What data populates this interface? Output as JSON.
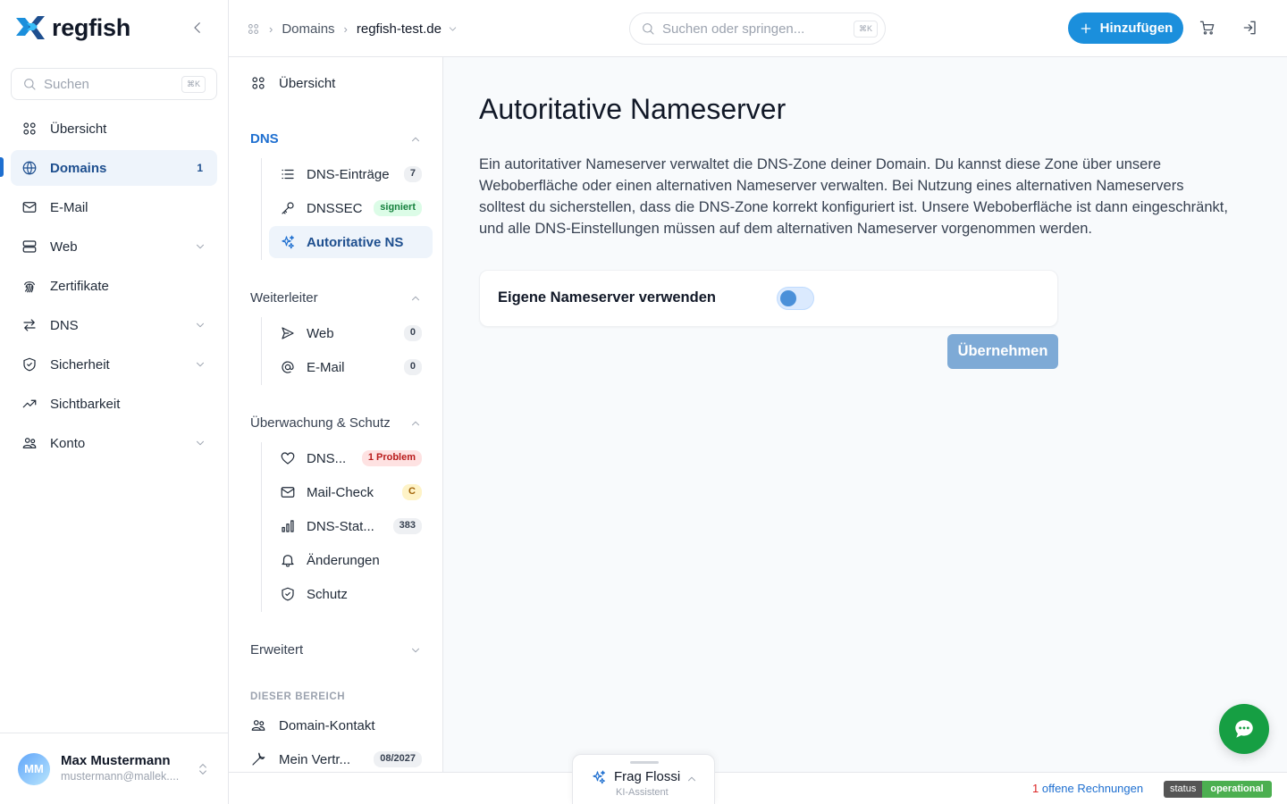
{
  "brand": {
    "name": "regfish"
  },
  "sidebar": {
    "search": {
      "placeholder": "Suchen",
      "shortcut": "⌘K"
    },
    "items": [
      {
        "label": "Übersicht",
        "icon": "grid-icon"
      },
      {
        "label": "Domains",
        "icon": "globe-icon",
        "count": "1",
        "active": true
      },
      {
        "label": "E-Mail",
        "icon": "mail-icon"
      },
      {
        "label": "Web",
        "icon": "server-icon",
        "expandable": true
      },
      {
        "label": "Zertifikate",
        "icon": "fingerprint-icon"
      },
      {
        "label": "DNS",
        "icon": "arrows-icon",
        "expandable": true
      },
      {
        "label": "Sicherheit",
        "icon": "shield-icon",
        "expandable": true
      },
      {
        "label": "Sichtbarkeit",
        "icon": "trend-icon"
      },
      {
        "label": "Konto",
        "icon": "users-icon",
        "expandable": true
      }
    ],
    "user": {
      "initials": "MM",
      "name": "Max Mustermann",
      "email": "mustermann@mallek...."
    }
  },
  "topbar": {
    "breadcrumb": {
      "root": "Domains",
      "current": "regfish-test.de"
    },
    "search": {
      "placeholder": "Suchen oder springen...",
      "shortcut": "⌘K"
    },
    "add_label": "Hinzufügen"
  },
  "subnav": {
    "overview": "Übersicht",
    "dns": {
      "title": "DNS",
      "items": [
        {
          "label": "DNS-Einträge",
          "badge": "7"
        },
        {
          "label": "DNSSEC",
          "badge": "signiert"
        },
        {
          "label": "Autoritative NS"
        }
      ]
    },
    "forward": {
      "title": "Weiterleiter",
      "items": [
        {
          "label": "Web",
          "badge": "0"
        },
        {
          "label": "E-Mail",
          "badge": "0"
        }
      ]
    },
    "monitor": {
      "title": "Überwachung & Schutz",
      "items": [
        {
          "label": "DNS...",
          "badge": "1 Problem"
        },
        {
          "label": "Mail-Check",
          "badge": "C"
        },
        {
          "label": "DNS-Stat...",
          "badge": "383"
        },
        {
          "label": "Änderungen"
        },
        {
          "label": "Schutz"
        }
      ]
    },
    "advanced": {
      "title": "Erweitert"
    },
    "section_label": "DIESER BEREICH",
    "area_items": [
      {
        "label": "Domain-Kontakt"
      },
      {
        "label": "Mein Vertr...",
        "badge": "08/2027"
      }
    ]
  },
  "main": {
    "title": "Autoritative Nameserver",
    "description": "Ein autoritativer Nameserver verwaltet die DNS-Zone deiner Domain. Du kannst diese Zone über unsere Weboberfläche oder einen alternativen Nameserver verwalten. Bei Nutzung eines alternativen Nameservers solltest du sicherstellen, dass die DNS-Zone korrekt konfiguriert ist. Unsere Weboberfläche ist dann eingeschränkt, und alle DNS-Einstellungen müssen auf dem alternativen Nameserver vorgenommen werden.",
    "toggle_label": "Eigene Nameserver verwenden",
    "apply_label": "Übernehmen"
  },
  "assistant": {
    "title": "Frag Flossi",
    "subtitle": "KI-Assistent"
  },
  "footer": {
    "invoices_count": "1",
    "invoices_label": " offene Rechnungen",
    "status_key": "status",
    "status_value": "operational"
  },
  "colors": {
    "accent": "#1b8fdc",
    "active_bg": "#eef4fb",
    "chat": "#169f43"
  }
}
